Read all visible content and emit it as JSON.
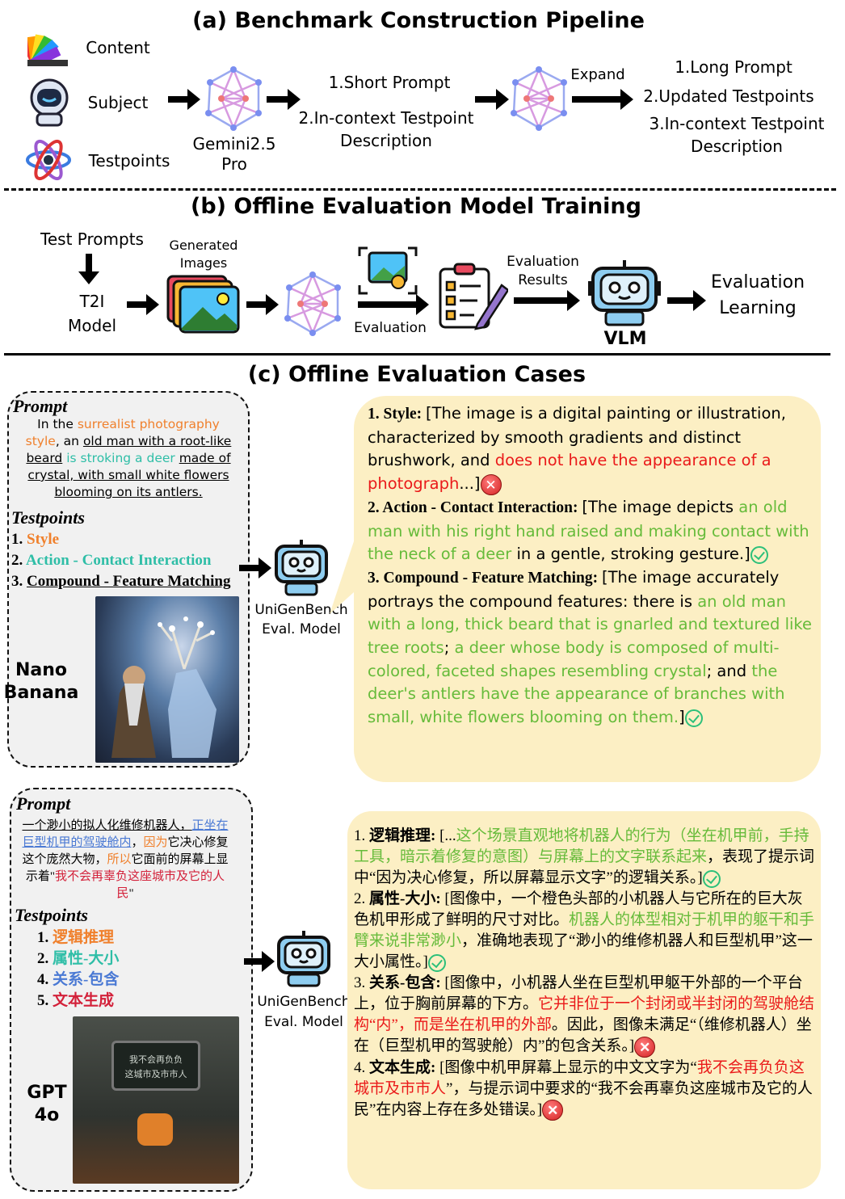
{
  "a": {
    "title": "(a) Benchmark Construction Pipeline",
    "inputs": [
      "Content",
      "Subject",
      "Testpoints"
    ],
    "model": [
      "Gemini2.5",
      "Pro"
    ],
    "stage1": [
      "1.Short Prompt",
      "2.In-context Testpoint",
      "Description"
    ],
    "expand": "Expand",
    "stage2": [
      "1.Long Prompt",
      "2.Updated Testpoints",
      "3.In-context Testpoint",
      "Description"
    ]
  },
  "b": {
    "title": "(b) Offline Evaluation Model Training",
    "test_prompts": "Test Prompts",
    "t2i": [
      "T2I",
      "Model"
    ],
    "generated": [
      "Generated",
      "Images"
    ],
    "evaluation": "Evaluation",
    "results": [
      "Evaluation",
      "Results"
    ],
    "vlm": "VLM",
    "learning": [
      "Evaluation",
      "Learning"
    ]
  },
  "c": {
    "title": "(c) Offline Evaluation Cases",
    "case1": {
      "prompt_heading": "Prompt",
      "prompt": [
        [
          {
            "t": "In the "
          },
          {
            "t": "surrealist photography",
            "c": "orange"
          }
        ],
        [
          {
            "t": "style",
            "c": "orange"
          },
          {
            "t": ", an "
          },
          {
            "t": "old man with a root-like",
            "c": "u"
          }
        ],
        [
          {
            "t": "beard",
            "c": "u"
          },
          {
            "t": " "
          },
          {
            "t": "is stroking a deer",
            "c": "teal"
          },
          {
            "t": " "
          },
          {
            "t": "made of",
            "c": "u"
          }
        ],
        [
          {
            "t": "crystal, with small white flowers",
            "c": "u"
          }
        ],
        [
          {
            "t": "blooming on its antlers.",
            "c": "u"
          }
        ]
      ],
      "testpoints_heading": "Testpoints",
      "testpoints": [
        {
          "n": "1. ",
          "t": "Style",
          "c": "orange"
        },
        {
          "n": "2. ",
          "t": "Action - Contact Interaction",
          "c": "teal"
        },
        {
          "n": "3. ",
          "t": "Compound - Feature Matching",
          "c": "u"
        }
      ],
      "model": [
        "Nano",
        "Banana"
      ],
      "evaluator": [
        "UniGenBench",
        "Eval. Model"
      ],
      "result": [
        [
          {
            "t": "1. Style: ",
            "c": "bold serif"
          },
          {
            "t": "[The image is a digital painting or illustration, characterized by smooth gradients and distinct brushwork, and "
          },
          {
            "t": "does not have the appearance of a photograph",
            "c": "red"
          },
          {
            "t": "...]"
          },
          {
            "i": "bad"
          }
        ],
        [
          {
            "t": "2. Action - Contact Interaction: ",
            "c": "bold serif"
          },
          {
            "t": "[The image depicts "
          },
          {
            "t": "an old man with his right hand raised and making contact with the neck of a deer",
            "c": "green"
          },
          {
            "t": " in a gentle, stroking gesture.]"
          },
          {
            "i": "ok"
          }
        ],
        [
          {
            "t": "3. Compound - Feature Matching: ",
            "c": "bold serif"
          },
          {
            "t": "[The image accurately portrays the compound features: there is "
          },
          {
            "t": "an old man with a long, thick beard that is gnarled and textured like tree roots",
            "c": "green"
          },
          {
            "t": "; "
          },
          {
            "t": "a deer whose body is composed of multi-colored, faceted shapes resembling crystal",
            "c": "green"
          },
          {
            "t": "; and "
          },
          {
            "t": "the deer's antlers have the appearance of branches with small, white flowers blooming on them.",
            "c": "green"
          },
          {
            "t": "]"
          },
          {
            "i": "ok"
          }
        ]
      ]
    },
    "case2": {
      "prompt_heading": "Prompt",
      "prompt": [
        [
          {
            "t": "一个渺小的拟人化维修机器人，",
            "c": "u"
          },
          {
            "t": "正坐在巨型机甲的驾驶舱内",
            "c": "blue u"
          },
          {
            "t": "，"
          },
          {
            "t": "因为",
            "c": "orange"
          },
          {
            "t": "它决心修复这个庞然大物，"
          },
          {
            "t": "所以",
            "c": "orange"
          },
          {
            "t": "它面前的屏幕上显示着\""
          },
          {
            "t": "我不会再辜负这座城市及它的人民",
            "c": "crimson"
          },
          {
            "t": "\""
          }
        ]
      ],
      "testpoints_heading": "Testpoints",
      "testpoints": [
        {
          "n": "1. ",
          "t": "逻辑推理",
          "c": "orange"
        },
        {
          "n": "2. ",
          "t": "属性-大小",
          "c": "teal"
        },
        {
          "n": "4. ",
          "t": "关系-包含",
          "c": "blue"
        },
        {
          "n": "5. ",
          "t": "文本生成",
          "c": "crimson"
        }
      ],
      "model": [
        "GPT",
        "4o"
      ],
      "image_text": [
        "我不会再负负",
        "这城市及市市人"
      ],
      "evaluator": [
        "UniGenBench",
        "Eval. Model"
      ],
      "result": [
        [
          {
            "t": "1. "
          },
          {
            "t": "逻辑推理: ",
            "c": "bold"
          },
          {
            "t": "[..."
          },
          {
            "t": "这个场景直观地将机器人的行为（坐在机甲前，手持工具，暗示着修复的意图）与屏幕上的文字联系起来",
            "c": "green"
          },
          {
            "t": "，表现了提示词中“因为决心修复，所以屏幕显示文字”的逻辑关系。]"
          },
          {
            "i": "ok"
          }
        ],
        [
          {
            "t": "2. "
          },
          {
            "t": "属性-大小: ",
            "c": "bold"
          },
          {
            "t": "[图像中，一个橙色头部的小机器人与它所在的巨大灰色机甲形成了鲜明的尺寸对比。"
          },
          {
            "t": "机器人的体型相对于机甲的躯干和手臂来说非常渺小",
            "c": "green"
          },
          {
            "t": "，准确地表现了“渺小的维修机器人和巨型机甲”这一大小属性。]"
          },
          {
            "i": "ok"
          }
        ],
        [
          {
            "t": "3. "
          },
          {
            "t": "关系-包含: ",
            "c": "bold"
          },
          {
            "t": "[图像中，小机器人坐在巨型机甲躯干外部的一个平台上，位于胸前屏幕的下方。"
          },
          {
            "t": "它并非位于一个封闭或半封闭的驾驶舱结构“内”，而是坐在机甲的外部",
            "c": "red"
          },
          {
            "t": "。因此，图像未满足“（维修机器人）坐在（巨型机甲的驾驶舱）内”的包含关系。]"
          },
          {
            "i": "bad"
          }
        ],
        [
          {
            "t": "4. "
          },
          {
            "t": "文本生成: ",
            "c": "bold"
          },
          {
            "t": "[图像中机甲屏幕上显示的中文文字为“"
          },
          {
            "t": "我不会再负负这城市及市市人",
            "c": "red"
          },
          {
            "t": "”，与提示词中要求的“我不会再辜负这座城市及它的人民”在内容上存在多处错误。]"
          },
          {
            "i": "bad"
          }
        ]
      ]
    }
  },
  "colors": {
    "bubble": "#fcefc4",
    "panel": "#f1f1f1",
    "green": "#66bb3a",
    "red": "#ea1a1a",
    "orange": "#f0802c",
    "teal": "#2fbea7",
    "blue": "#4a79d4"
  }
}
